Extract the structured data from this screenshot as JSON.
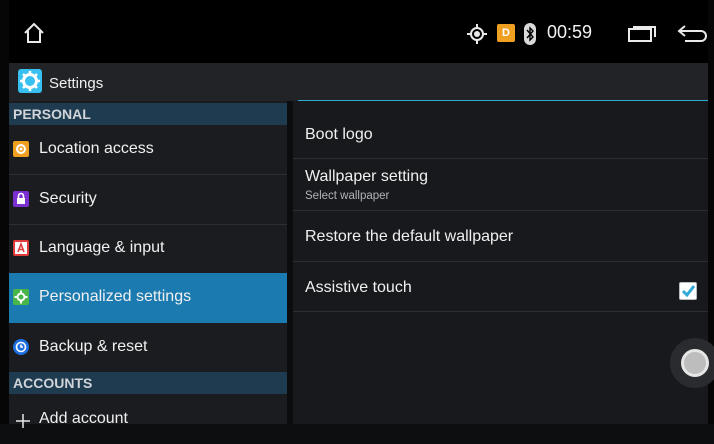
{
  "status_bar": {
    "time": "00:59",
    "app_badge_letter": "D",
    "icons": [
      "home-icon",
      "location-icon",
      "app-notification-icon",
      "bluetooth-icon",
      "recents-icon",
      "back-icon"
    ]
  },
  "action_bar": {
    "title": "Settings",
    "icon": "settings-gear-icon",
    "accent_color": "#2fa9d6"
  },
  "left_pane": {
    "sections": [
      {
        "header": "PERSONAL"
      },
      {
        "header": "ACCOUNTS"
      }
    ],
    "items": [
      {
        "label": "Location access",
        "icon": "location-icon",
        "icon_color": "#f0a020"
      },
      {
        "label": "Security",
        "icon": "lock-icon",
        "icon_color": "#7a2fd0"
      },
      {
        "label": "Language & input",
        "icon": "keyboard-a-icon",
        "icon_color": "#e03a3a"
      },
      {
        "label": "Personalized settings",
        "icon": "personalize-gear-icon",
        "icon_color": "#49b649",
        "active": true
      },
      {
        "label": "Backup & reset",
        "icon": "backup-icon",
        "icon_color": "#1e6fe0"
      },
      {
        "label": "Add account",
        "icon": "plus-icon"
      }
    ],
    "active_color": "#1b7bb0"
  },
  "right_pane": {
    "rows": [
      {
        "title": "Boot logo"
      },
      {
        "title": "Wallpaper setting",
        "summary": "Select wallpaper"
      },
      {
        "title": "Restore the default wallpaper"
      },
      {
        "title": "Assistive touch",
        "checked": true
      }
    ]
  }
}
